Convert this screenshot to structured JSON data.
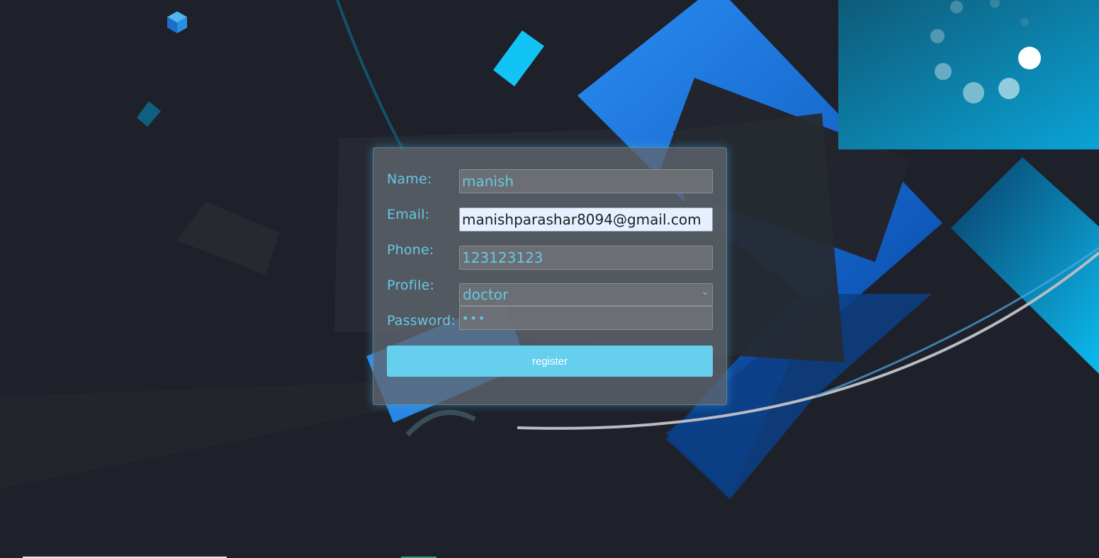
{
  "form": {
    "labels": {
      "name": "Name:",
      "email": "Email:",
      "phone": "Phone:",
      "profile": "Profile:",
      "password": "Password:"
    },
    "values": {
      "name": "manish",
      "email": "manishparashar8094@gmail.com",
      "phone": "123123123",
      "profile": "doctor",
      "password": "•••"
    },
    "submit_label": "register"
  },
  "icons": {
    "logo": "cube-logo-icon",
    "select_arrow": "chevron-down-icon"
  },
  "colors": {
    "background": "#1e2129",
    "label_text": "#64c8e6",
    "button": "#66cfee",
    "autofill_field": "#e6f0fe",
    "accent_blue": "#1a73d9"
  }
}
